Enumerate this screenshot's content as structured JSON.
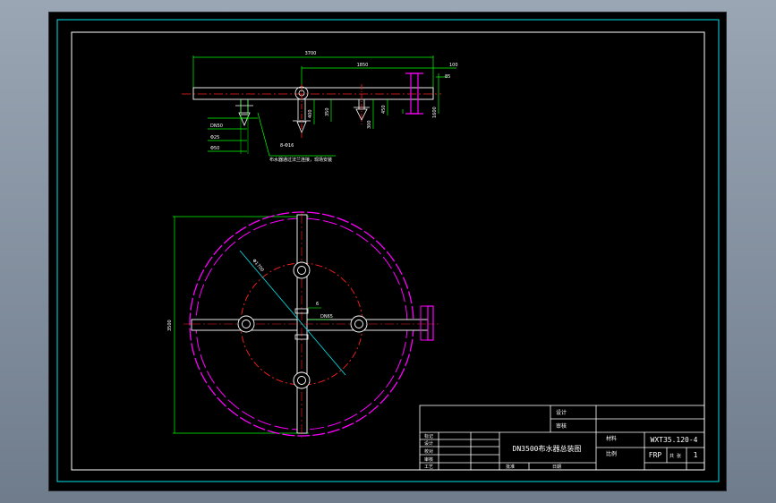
{
  "top_view_dimensions": {
    "overall_length": "3700",
    "center_to_end": "1850",
    "end_offset": "100",
    "flange_small": "85",
    "nozzle_depth_1": "350",
    "nozzle_depth_2": "400",
    "nozzle_depth_3": "300",
    "nozzle_depth_4": "450",
    "flange_height": "1600"
  },
  "nozzle_detail": {
    "label_1": "DN50",
    "label_2": "Φ25",
    "label_3": "Φ50",
    "spec_label": "8-Φ16",
    "note": "布水器通过法兰连接，现场安装"
  },
  "plan_view_dimensions": {
    "diameter_vertical": "3500",
    "circle_diameter": "Φ1700",
    "pipe_size": "DN65",
    "small_dim": "6"
  },
  "title_block": {
    "drawing_name": "DN3500布水器总装图",
    "drawing_number": "WXT35.120-4",
    "material": "FRP",
    "sheet_count": "1",
    "header_cell_1": "设计",
    "header_cell_2": "审核",
    "label_material": "材料",
    "label_scale": "比例",
    "label_sheet": "共 张",
    "rev_rows": [
      "标记",
      "设计",
      "校对",
      "审核",
      "工艺"
    ],
    "bottom_cells": [
      "批准",
      "日期"
    ]
  }
}
